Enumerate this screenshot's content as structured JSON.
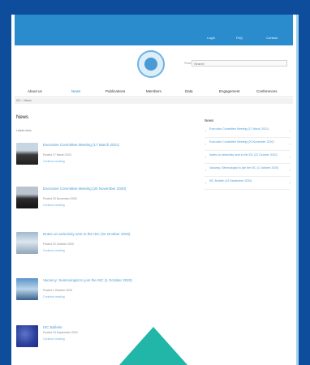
{
  "topbar": {
    "buttons": [
      "Login",
      "FAQ",
      "Contact"
    ]
  },
  "search": {
    "label": "Search",
    "placeholder": "Search"
  },
  "nav": {
    "items": [
      {
        "label": "About us",
        "active": false
      },
      {
        "label": "News",
        "active": true
      },
      {
        "label": "Publications",
        "active": false
      },
      {
        "label": "Members",
        "active": false
      },
      {
        "label": "Data",
        "active": false
      },
      {
        "label": "Engagement",
        "active": false
      },
      {
        "label": "Conferences",
        "active": false
      }
    ]
  },
  "breadcrumb": "ISC > News",
  "main": {
    "title": "News",
    "subtitle": "Latest news",
    "news": [
      {
        "title": "Executive Committee Meeting (17 March 2021)",
        "date": "Posted 17 March 2021",
        "more": "Continue reading"
      },
      {
        "title": "Executive Committee Meeting (20 November 2020)",
        "date": "Posted 20 November 2020",
        "more": "Continue reading"
      },
      {
        "title": "Notes on seismicity sent to the ISC (22 October 2020)",
        "date": "Posted 22 October 2020",
        "more": "Continue reading"
      },
      {
        "title": "Vacancy: Seismologist to join the ISC (1 October 2020)",
        "date": "Posted 1 October 2020",
        "more": "Continue reading"
      },
      {
        "title": "ISC Bulletin",
        "date": "Posted 15 September 2020",
        "more": "Continue reading"
      }
    ]
  },
  "sidebar": {
    "head": "News",
    "items": [
      "Executive Committee Meeting (17 March 2021)",
      "Executive Committee Meeting (20 November 2020)",
      "Notes on seismicity sent to the ISC (22 October 2020)",
      "Vacancy: Seismologist to join the ISC (1 October 2020)",
      "ISC Bulletin (15 September 2020)"
    ]
  }
}
